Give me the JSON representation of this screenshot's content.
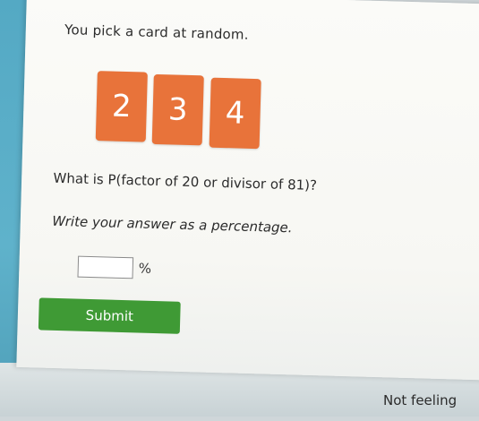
{
  "problem": {
    "prompt": "You pick a card at random.",
    "cards": [
      "2",
      "3",
      "4"
    ],
    "question": "What is P(factor of 20 or divisor of 81)?",
    "instruction": "Write your answer as a percentage.",
    "answer_value": "",
    "unit": "%"
  },
  "actions": {
    "submit_label": "Submit"
  },
  "footer": {
    "not_feeling_label": "Not feeling"
  },
  "colors": {
    "card": "#e8733a",
    "submit": "#3f9a35",
    "left_strip": "#54a9c4"
  }
}
